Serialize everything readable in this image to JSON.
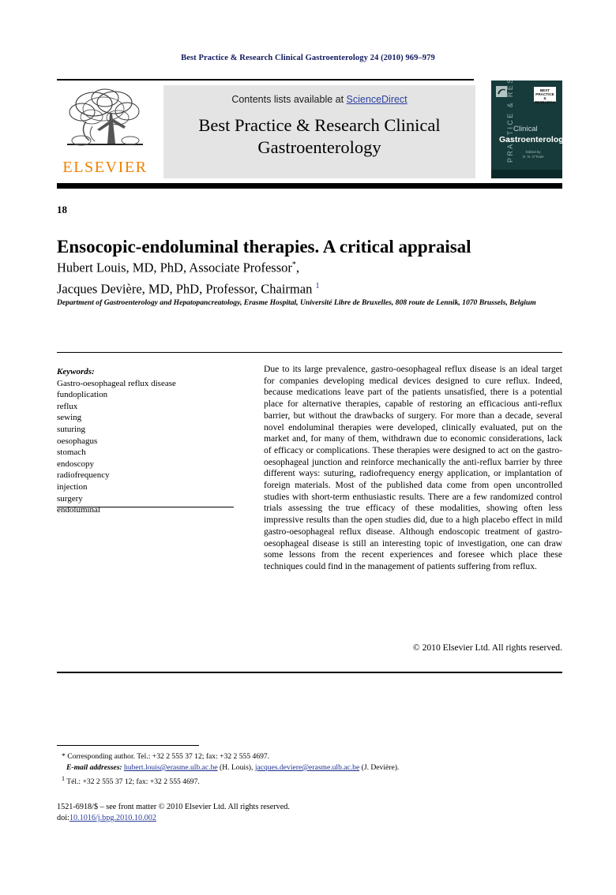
{
  "running_head": "Best Practice & Research Clinical Gastroenterology 24 (2010) 969–979",
  "masthead": {
    "contents_prefix": "Contents lists available at ",
    "sciencedirect": "ScienceDirect",
    "journal_title": "Best Practice & Research Clinical Gastroenterology",
    "publisher_logo_text": "ELSEVIER",
    "publisher_color": "#f08000",
    "cover": {
      "vertical_text": "PRACTICE & RESEARCH",
      "badge_text": "BEST PRACTICE & RESEARCH",
      "line_clinical": "Clinical",
      "line_gastro": "Gastroenterology",
      "editor_label": "Edited by",
      "editor_name": "D. N. O'Toole",
      "background_color": "#173b3a"
    }
  },
  "article": {
    "number": "18",
    "title": "Ensocopic-endoluminal therapies. A critical appraisal",
    "authors": [
      {
        "name": "Hubert Louis, MD, PhD, Associate Professor",
        "marker": "*",
        "trailing": ","
      },
      {
        "name": "Jacques Devière, MD, PhD, Professor, Chairman",
        "marker": "1",
        "trailing": ""
      }
    ],
    "affiliation": "Department of Gastroenterology and Hepatopancreatology, Erasme Hospital, Université Libre de Bruxelles, 808 route de Lennik, 1070 Brussels, Belgium"
  },
  "keywords": {
    "heading": "Keywords:",
    "items": [
      "Gastro-oesophageal reflux disease",
      "fundoplication",
      "reflux",
      "sewing",
      "suturing",
      "oesophagus",
      "stomach",
      "endoscopy",
      "radiofrequency",
      "injection",
      "surgery",
      "endoluminal"
    ]
  },
  "abstract": {
    "text": "Due to its large prevalence, gastro-oesophageal reflux disease is an ideal target for companies developing medical devices designed to cure reflux. Indeed, because medications leave part of the patients unsatisfied, there is a potential place for alternative therapies, capable of restoring an efficacious anti-reflux barrier, but without the drawbacks of surgery. For more than a decade, several novel endoluminal therapies were developed, clinically evaluated, put on the market and, for many of them, withdrawn due to economic considerations, lack of efficacy or complications. These therapies were designed to act on the gastro-oesophageal junction and reinforce mechanically the anti-reflux barrier by three different ways: suturing, radiofrequency energy application, or implantation of foreign materials. Most of the published data come from open uncontrolled studies with short-term enthusiastic results. There are a few randomized control trials assessing the true efficacy of these modalities, showing often less impressive results than the open studies did, due to a high placebo effect in mild gastro-oesophageal reflux disease. Although endoscopic treatment of gastro-oesophageal disease is still an interesting topic of investigation, one can draw some lessons from the recent experiences and foresee which place these techniques could find in the management of patients suffering from reflux.",
    "copyright": "© 2010 Elsevier Ltd. All rights reserved."
  },
  "footnotes": {
    "corresponding_marker": "*",
    "corresponding": "Corresponding author. Tel.: +32 2 555 37 12; fax: +32 2 555 4697.",
    "email_label": "E-mail addresses:",
    "email_1": "hubert.louis@erasme.ulb.ac.be",
    "email_1_owner": "(H. Louis)",
    "email_2": "jacques.deviere@erasme.ulb.ac.be",
    "email_2_owner": "(J. Devière).",
    "note_marker": "1",
    "note_1": "Tél.: +32 2 555 37 12; fax: +32 2 555 4697."
  },
  "colophon": {
    "issn_line": "1521-6918/$ – see front matter © 2010 Elsevier Ltd. All rights reserved.",
    "doi_label": "doi:",
    "doi_value": "10.1016/j.bpg.2010.10.002"
  }
}
